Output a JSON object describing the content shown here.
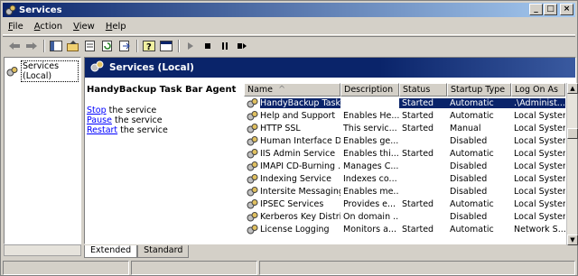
{
  "window": {
    "title": "Services",
    "icon": "services-gear-icon",
    "buttons": {
      "minimize": "_",
      "maximize": "□",
      "close": "×"
    }
  },
  "menu": [
    {
      "label": "File",
      "accel": "F"
    },
    {
      "label": "Action",
      "accel": "A"
    },
    {
      "label": "View",
      "accel": "V"
    },
    {
      "label": "Help",
      "accel": "H"
    }
  ],
  "tree": {
    "root_label": "Services (Local)"
  },
  "panel": {
    "header": "Services (Local)",
    "selected_service": "HandyBackup Task Bar Agent",
    "actions": [
      {
        "link": "Stop",
        "rest": " the service"
      },
      {
        "link": "Pause",
        "rest": " the service"
      },
      {
        "link": "Restart",
        "rest": " the service"
      }
    ]
  },
  "list": {
    "columns": [
      "Name",
      "Description",
      "Status",
      "Startup Type",
      "Log On As"
    ],
    "sort_indicator": "^",
    "rows": [
      {
        "name": "HandyBackup Task ...",
        "desc": "",
        "status": "Started",
        "startup": "Automatic",
        "logon": ".\\Administ...",
        "selected": true
      },
      {
        "name": "Help and Support",
        "desc": "Enables He...",
        "status": "Started",
        "startup": "Automatic",
        "logon": "Local System"
      },
      {
        "name": "HTTP SSL",
        "desc": "This servic...",
        "status": "Started",
        "startup": "Manual",
        "logon": "Local System"
      },
      {
        "name": "Human Interface D...",
        "desc": "Enables ge...",
        "status": "",
        "startup": "Disabled",
        "logon": "Local System"
      },
      {
        "name": "IIS Admin Service",
        "desc": "Enables thi...",
        "status": "Started",
        "startup": "Automatic",
        "logon": "Local System"
      },
      {
        "name": "IMAPI CD-Burning ...",
        "desc": "Manages C...",
        "status": "",
        "startup": "Disabled",
        "logon": "Local System"
      },
      {
        "name": "Indexing Service",
        "desc": "Indexes co...",
        "status": "",
        "startup": "Disabled",
        "logon": "Local System"
      },
      {
        "name": "Intersite Messaging",
        "desc": "Enables me...",
        "status": "",
        "startup": "Disabled",
        "logon": "Local System"
      },
      {
        "name": "IPSEC Services",
        "desc": "Provides e...",
        "status": "Started",
        "startup": "Automatic",
        "logon": "Local System"
      },
      {
        "name": "Kerberos Key Distri...",
        "desc": "On domain ...",
        "status": "",
        "startup": "Disabled",
        "logon": "Local System"
      },
      {
        "name": "License Logging",
        "desc": "Monitors a...",
        "status": "Started",
        "startup": "Automatic",
        "logon": "Network S..."
      }
    ]
  },
  "tabs": [
    {
      "label": "Extended",
      "active": true
    },
    {
      "label": "Standard",
      "active": false
    }
  ],
  "colors": {
    "title_bar": "#0a246a",
    "selection": "#0a246a",
    "chrome": "#d4d0c8",
    "link": "#0000ff"
  }
}
